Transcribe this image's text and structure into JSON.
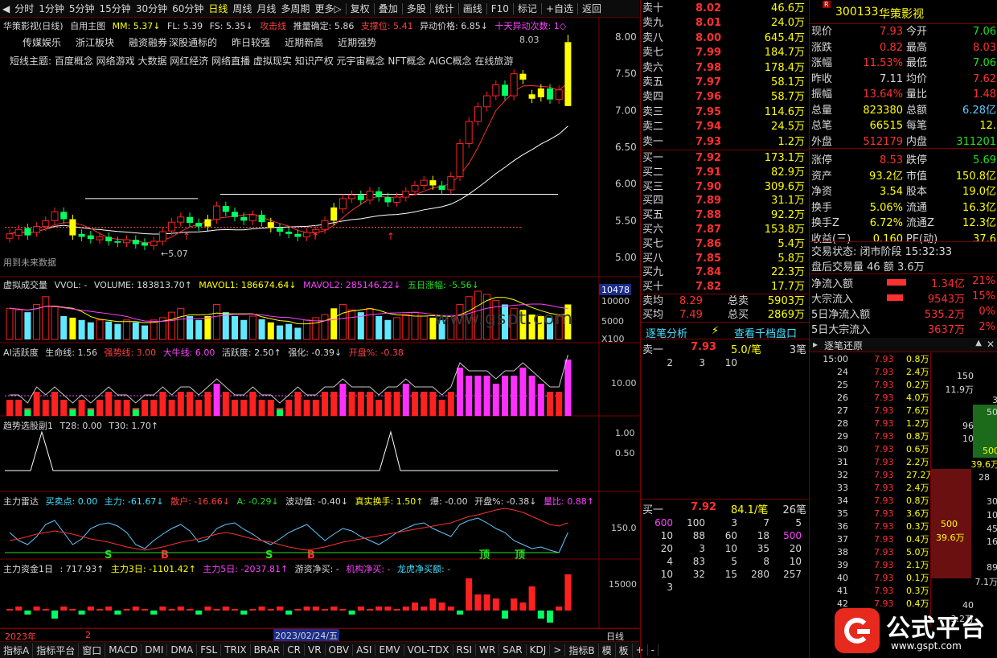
{
  "toolbar": {
    "periods": [
      "分时",
      "1分钟",
      "5分钟",
      "15分钟",
      "30分钟",
      "60分钟",
      "日线",
      "周线",
      "月线",
      "多周期",
      "更多▷"
    ],
    "actions": [
      "复权",
      "叠加",
      "多股",
      "统计",
      "画线",
      "F10",
      "标记",
      "+自选",
      "返回"
    ]
  },
  "stock_header": {
    "name": "华策影视(日线)",
    "main_fig": "自用主图",
    "mm": "MM: 5.37↓",
    "fl": "FL: 5.39",
    "fs": "FS: 5.35↓",
    "attack": "攻击线",
    "push": "推量确定: 5.86",
    "support": "支撑位: 5.41",
    "abnormal": "异动价格: 6.85↓",
    "days": "十天异动次数: 1◇"
  },
  "tags": [
    "传媒娱乐",
    "浙江板块",
    "融资融券",
    "深股通标的",
    "昨日较强",
    "近期新高",
    "近期强势"
  ],
  "themes": "短线主题: 百度概念 网络游戏 大数据 网红经济 网络直播 虚拟现实 知识产权 元宇宙概念 NFT概念 AIGC概念 在线旅游",
  "future_note": "用到未来数据",
  "price_axis": [
    "8.00",
    "7.50",
    "7.00",
    "6.50",
    "6.00",
    "5.50",
    "5.00"
  ],
  "annot_high": "8.03",
  "annot_low": "5.07",
  "vol_header": {
    "name": "虚拟成交量",
    "vvol": "VVOL: -",
    "volume": "VOLUME: 183813.70↑",
    "mavol1": "MAVOL1: 186674.64↓",
    "mavol2": "MAVOL2: 285146.22↓",
    "rise5": "五日涨幅: -5.56↓"
  },
  "vol_axis": {
    "top": "10478",
    "mid1": "10000",
    "mid2": "5000",
    "unit": "X100"
  },
  "ai_header": {
    "name": "AI活跃度",
    "life": "生命线: 1.56",
    "strong": "强势线: 3.00",
    "bull": "大牛线: 6.00",
    "act": "活跃度: 2.50↑",
    "qh": "强化: -0.39↓",
    "open": "开盘%: -0.38"
  },
  "ai_axis": [
    "10.00"
  ],
  "trend_header": {
    "name": "趋势选股副1",
    "t28": "T28: 0.00",
    "t30": "T30: 1.70↑"
  },
  "trend_axis": [
    "1.00",
    "0.50"
  ],
  "radar_header": {
    "name": "主力雷达",
    "bs": "买卖点: 0.00",
    "zl": "主力: -61.67↓",
    "sh": "散户: -16.66↓",
    "a": "A: -0.29↓",
    "bd": "波动值: -0.40↓",
    "hs": "真实换手: 1.50↑",
    "bao": "爆: -0.00",
    "kp": "开盘%: -0.38↓",
    "lb": "量比: 0.88↑"
  },
  "radar_axis": [
    "150.0"
  ],
  "radar_marks": {
    "s": "S",
    "b": "B",
    "ding": "顶"
  },
  "fund_header": {
    "name": "主力资金1日",
    "v1": ": 717.93↑",
    "v3": "主力3日: -1101.42↑",
    "v5": "主力5日: -2037.81↑",
    "yz": "游资净买: -",
    "jg": "机构净买: -",
    "lh": "龙虎净买额: -"
  },
  "fund_axis": [
    "15000"
  ],
  "date_bar": {
    "year": "2023年",
    "month": "2",
    "date": "2023/02/24/五",
    "period": "日线"
  },
  "bottom_tabs": [
    "指标A",
    "指标平台",
    "窗口",
    "MACD",
    "DMI",
    "DMA",
    "FSL",
    "TRIX",
    "BRAR",
    "CR",
    "VR",
    "OBV",
    "ASI",
    "EMV",
    "VOL-TDX",
    "RSI",
    "WR",
    "SAR",
    "KDJ",
    ">",
    "指标B",
    "模",
    "板",
    "+",
    "-"
  ],
  "orderbook": {
    "asks": [
      [
        "卖十",
        "8.02",
        "46.6万"
      ],
      [
        "卖九",
        "8.01",
        "24.0万"
      ],
      [
        "卖八",
        "8.00",
        "645.4万"
      ],
      [
        "卖七",
        "7.99",
        "184.7万"
      ],
      [
        "卖六",
        "7.98",
        "178.4万"
      ],
      [
        "卖五",
        "7.97",
        "58.1万"
      ],
      [
        "卖四",
        "7.96",
        "58.7万"
      ],
      [
        "卖三",
        "7.95",
        "114.6万"
      ],
      [
        "卖二",
        "7.94",
        "24.5万"
      ],
      [
        "卖一",
        "7.93",
        "1.2万"
      ]
    ],
    "bids": [
      [
        "买一",
        "7.92",
        "173.1万"
      ],
      [
        "买二",
        "7.91",
        "82.9万"
      ],
      [
        "买三",
        "7.90",
        "309.6万"
      ],
      [
        "买四",
        "7.89",
        "31.1万"
      ],
      [
        "买五",
        "7.88",
        "92.2万"
      ],
      [
        "买六",
        "7.87",
        "153.8万"
      ],
      [
        "买七",
        "7.86",
        "5.4万"
      ],
      [
        "买八",
        "7.85",
        "5.8万"
      ],
      [
        "买九",
        "7.84",
        "22.3万"
      ],
      [
        "买十",
        "7.82",
        "17.7万"
      ]
    ],
    "avg": [
      [
        "卖均",
        "8.29",
        "总卖",
        "5903万"
      ],
      [
        "买均",
        "7.49",
        "总买",
        "2869万"
      ]
    ]
  },
  "tick_analysis": {
    "left": "逐笔分析",
    "right": "查看千档盘口"
  },
  "sell1_queue": {
    "label": "卖一",
    "price": "7.93",
    "per": "5.0/笔",
    "cnt": "3笔",
    "rows": [
      [
        "2",
        "3",
        "10"
      ]
    ]
  },
  "buy1_queue": {
    "label": "买一",
    "price": "7.92",
    "per": "84.1/笔",
    "cnt": "26笔",
    "rows": [
      [
        "600",
        "100",
        "3",
        "7",
        "5"
      ],
      [
        "10",
        "88",
        "60",
        "18",
        "500"
      ],
      [
        "20",
        "3",
        "10",
        "35",
        "20"
      ],
      [
        "4",
        "83",
        "5",
        "8",
        "10"
      ],
      [
        "10",
        "32",
        "15",
        "280",
        "257"
      ],
      [
        "3"
      ]
    ]
  },
  "quote": {
    "code": "300133",
    "name": "华策影视",
    "badge": "R",
    "rows": [
      [
        "现价",
        "7.93",
        "今开",
        "7.06"
      ],
      [
        "涨跌",
        "0.82",
        "最高",
        "8.03"
      ],
      [
        "涨幅",
        "11.53%",
        "最低",
        "7.06"
      ],
      [
        "昨收",
        "7.11",
        "均价",
        "7.62"
      ],
      [
        "振幅",
        "13.64%",
        "量比",
        "1.48"
      ],
      [
        "总量",
        "823380",
        "总额",
        "6.28亿"
      ],
      [
        "总笔",
        "66515",
        "每笔",
        "12."
      ],
      [
        "外盘",
        "512179",
        "内盘",
        "311201"
      ],
      [
        "涨停",
        "8.53",
        "跌停",
        "5.69"
      ],
      [
        "资产",
        "93.2亿",
        "市值",
        "150.8亿"
      ],
      [
        "净资",
        "3.54",
        "股本",
        "19.0亿"
      ],
      [
        "换手",
        "5.06%",
        "流通",
        "16.3亿"
      ],
      [
        "换手Z",
        "6.72%",
        "流通Z",
        "12.3亿"
      ],
      [
        "收益(三)",
        "0.160",
        "PE(动)",
        "37.6"
      ]
    ],
    "status": "交易状态: 闭市阶段 15:32:33",
    "after": "盘后交易量 46 额 3.6万",
    "flows": [
      [
        "净流入额",
        "1.34亿",
        "21%"
      ],
      [
        "大宗流入",
        "9543万",
        "15%"
      ],
      [
        "5日净流入额",
        "535.2万",
        "0%"
      ],
      [
        "5日大宗流入",
        "3637万",
        "2%"
      ]
    ]
  },
  "ticks": {
    "title": "逐笔还原",
    "rows": [
      [
        "15:00",
        "7.93",
        "0.8万"
      ],
      [
        "24",
        "7.93",
        "2.4万"
      ],
      [
        "25",
        "7.93",
        "0.2万"
      ],
      [
        "26",
        "7.93",
        "4.0万"
      ],
      [
        "27",
        "7.93",
        "7.6万"
      ],
      [
        "28",
        "7.93",
        "1.2万"
      ],
      [
        "29",
        "7.93",
        "0.8万"
      ],
      [
        "30",
        "7.93",
        "0.6万"
      ],
      [
        "31",
        "7.93",
        "2.2万"
      ],
      [
        "32",
        "7.93",
        "27.2万"
      ],
      [
        "33",
        "7.93",
        "2.4万"
      ],
      [
        "34",
        "7.93",
        "0.8万"
      ],
      [
        "35",
        "7.93",
        "3.6万"
      ],
      [
        "36",
        "7.93",
        "0.3万"
      ],
      [
        "37",
        "7.93",
        "0.4万"
      ],
      [
        "38",
        "7.93",
        "5.0万"
      ],
      [
        "39",
        "7.93",
        "2.1万"
      ],
      [
        "40",
        "7.93",
        "0.1万"
      ],
      [
        "41",
        "7.93",
        "0.3万"
      ],
      [
        "42",
        "7.93",
        "0.4万"
      ]
    ],
    "side": [
      "150",
      "11.9万",
      "3",
      "50",
      "96",
      "10",
      "500",
      "39.6万",
      "28",
      "30",
      "10",
      "45",
      "16",
      "89",
      "7.1万",
      "40",
      "3.2万"
    ]
  },
  "watermark": "公式平台",
  "watermark_url": "www.gspt.com",
  "watermark_url2": "www.gspt.com",
  "colors": {
    "up": "#ff2020",
    "down": "#00ff60",
    "hl": "#ffff00",
    "cyan": "#60e8ff",
    "magenta": "#ff30ff"
  }
}
